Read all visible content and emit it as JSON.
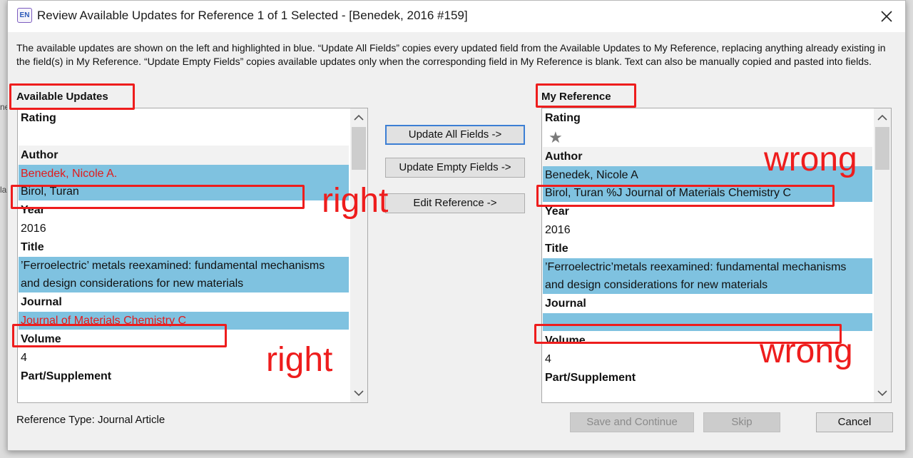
{
  "window": {
    "app_icon": "EN",
    "title": "Review Available Updates for Reference 1 of 1 Selected - [Benedek, 2016 #159]",
    "close_icon": "close-icon"
  },
  "description": "The available updates are shown on the left and highlighted in blue. “Update All Fields” copies every updated field from the Available Updates to My Reference, replacing anything already existing in the field(s) in My Reference. “Update Empty Fields” copies available updates only when the corresponding field in My Reference is blank. Text can also be manually copied and pasted into fields.",
  "available_updates": {
    "label": "Available Updates",
    "rating_label": "Rating",
    "author_label": "Author",
    "authors": [
      "Benedek, Nicole A.",
      "Birol, Turan"
    ],
    "year_label": "Year",
    "year": "2016",
    "title_label": "Title",
    "title_lines": [
      "’Ferroelectric’ metals reexamined: fundamental mechanisms",
      "and design considerations for new materials"
    ],
    "journal_label": "Journal",
    "journal": "Journal of Materials Chemistry C",
    "volume_label": "Volume",
    "volume": "4",
    "part_label": "Part/Supplement"
  },
  "my_reference": {
    "label": "My Reference",
    "rating_label": "Rating",
    "rating_icon": "star-icon",
    "author_label": "Author",
    "authors": [
      "Benedek, Nicole A",
      "Birol, Turan %J Journal of Materials Chemistry C"
    ],
    "year_label": "Year",
    "year": "2016",
    "title_label": "Title",
    "title_lines": [
      "’Ferroelectric’metals reexamined: fundamental mechanisms",
      "and design considerations for new materials"
    ],
    "journal_label": "Journal",
    "journal": "",
    "volume_label": "Volume",
    "volume": "4",
    "part_label": "Part/Supplement"
  },
  "buttons": {
    "update_all": "Update All Fields ->",
    "update_empty": "Update Empty Fields ->",
    "edit_reference": "Edit Reference ->",
    "save_continue": "Save and Continue",
    "skip": "Skip",
    "cancel": "Cancel"
  },
  "reference_type": "Reference Type: Journal Article",
  "annotations": {
    "right_1": "right",
    "right_2": "right",
    "wrong_1": "wrong",
    "wrong_2": "wrong",
    "color": "#ee1d1d"
  },
  "background_fragments": [
    "ne",
    "la"
  ],
  "colors": {
    "highlight": "#7fc2e0",
    "update_text": "#e21b1b",
    "focus_border": "#3c7fd4"
  }
}
